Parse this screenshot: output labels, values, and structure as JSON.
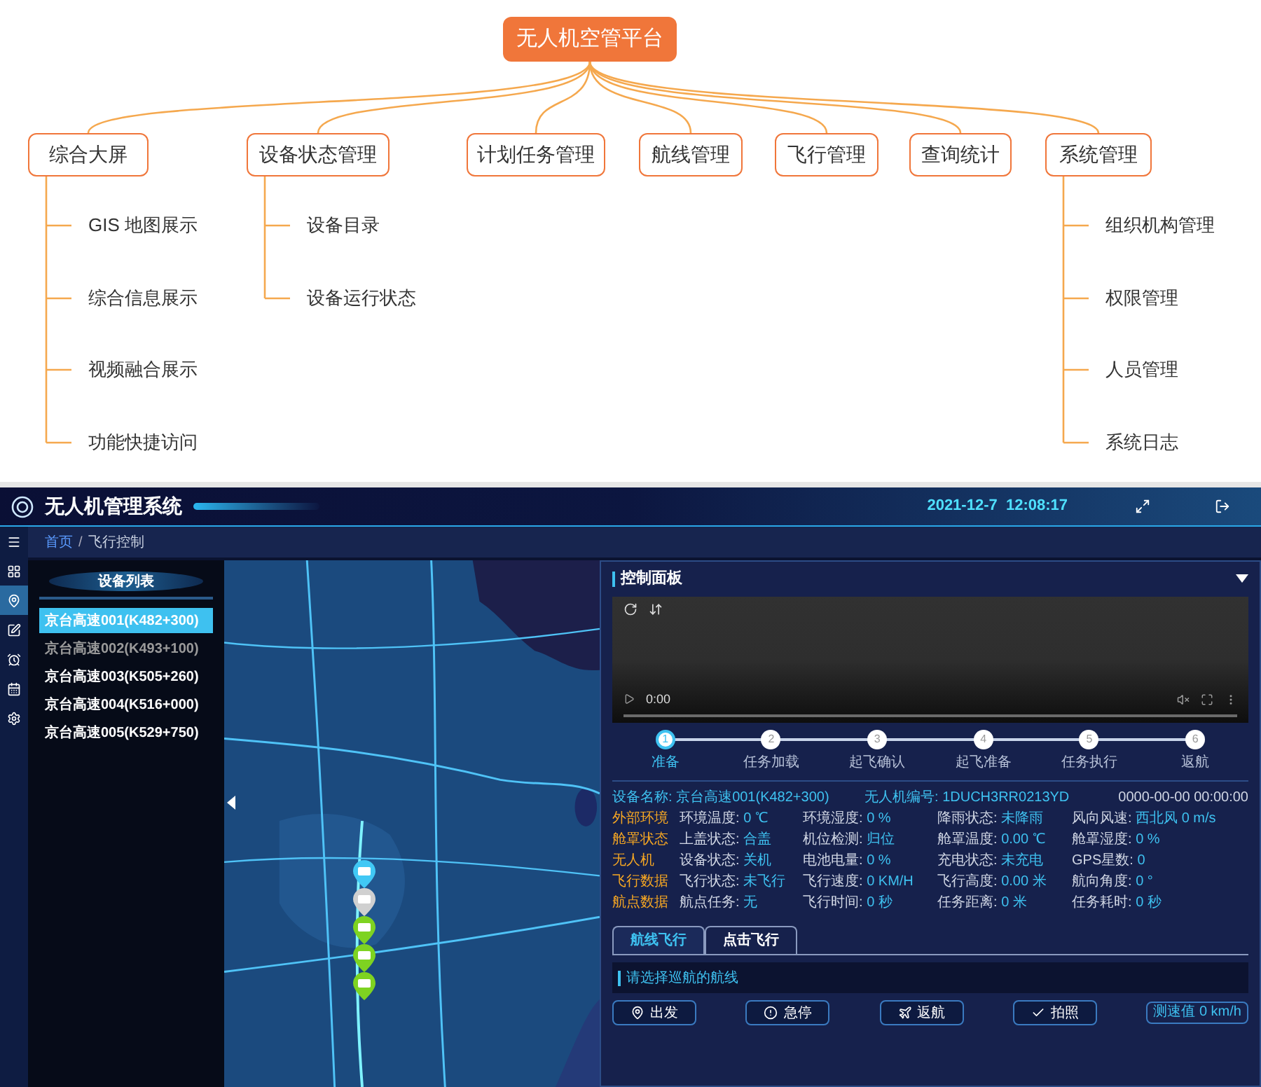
{
  "diagram": {
    "root": "无人机空管平台",
    "branches": [
      {
        "label": "综合大屏",
        "children": [
          "GIS 地图展示",
          "综合信息展示",
          "视频融合展示",
          "功能快捷访问"
        ]
      },
      {
        "label": "设备状态管理",
        "children": [
          "设备目录",
          "设备运行状态"
        ]
      },
      {
        "label": "计划任务管理"
      },
      {
        "label": "航线管理"
      },
      {
        "label": "飞行管理"
      },
      {
        "label": "查询统计"
      },
      {
        "label": "系统管理",
        "children": [
          "组织机构管理",
          "权限管理",
          "人员管理",
          "系统日志"
        ]
      }
    ]
  },
  "app": {
    "header": {
      "title": "无人机管理系统",
      "datetime": "2021-12-7  12:08:17"
    },
    "nav": [
      {
        "selected": false
      },
      {
        "selected": false
      },
      {
        "selected": true
      },
      {
        "selected": false
      },
      {
        "selected": false
      },
      {
        "selected": false
      },
      {
        "selected": false
      }
    ],
    "breadcrumb": {
      "items": [
        "首页",
        "飞行控制"
      ],
      "separator": "/"
    },
    "device_list": {
      "title": "设备列表",
      "items": [
        {
          "label": "京台高速001(K482+300)",
          "selected": true,
          "online": true
        },
        {
          "label": "京台高速002(K493+100)",
          "selected": false,
          "online": false
        },
        {
          "label": "京台高速003(K505+260)",
          "selected": false,
          "online": true
        },
        {
          "label": "京台高速004(K516+000)",
          "selected": false,
          "online": true
        },
        {
          "label": "京台高速005(K529+750)",
          "selected": false,
          "online": true
        }
      ]
    },
    "map": {
      "markers": [
        {
          "color": "#41c8f5"
        },
        {
          "color": "#d0d0d0"
        },
        {
          "color": "#7ed321"
        },
        {
          "color": "#7ed321"
        },
        {
          "color": "#7ed321"
        }
      ]
    },
    "control_panel": {
      "title": "控制面板",
      "video": {
        "time": "0:00"
      },
      "steps": [
        {
          "number": "1",
          "label": "准备",
          "selected": true
        },
        {
          "number": "2",
          "label": "任务加载",
          "selected": false
        },
        {
          "number": "3",
          "label": "起飞确认",
          "selected": false
        },
        {
          "number": "4",
          "label": "起飞准备",
          "selected": false
        },
        {
          "number": "5",
          "label": "任务执行",
          "selected": false
        },
        {
          "number": "6",
          "label": "返航",
          "selected": false
        }
      ],
      "device": {
        "name_label": "设备名称:",
        "name": "京台高速001(K482+300)",
        "id_label": "无人机编号:",
        "id": "1DUCH3RR0213YD",
        "timestamp": "0000-00-00 00:00:00"
      },
      "groups": [
        {
          "category": "外部环境",
          "fields": [
            {
              "label": "环境温度:",
              "value": "0 ℃"
            },
            {
              "label": "环境湿度:",
              "value": "0 %"
            },
            {
              "label": "降雨状态:",
              "value": "未降雨"
            },
            {
              "label": "风向风速:",
              "value": "西北风 0 m/s"
            }
          ]
        },
        {
          "category": "舱罩状态",
          "fields": [
            {
              "label": "上盖状态:",
              "value": "合盖"
            },
            {
              "label": "机位检测:",
              "value": "归位"
            },
            {
              "label": "舱罩温度:",
              "value": "0.00 ℃"
            },
            {
              "label": "舱罩湿度:",
              "value": "0 %"
            }
          ]
        },
        {
          "category": "无人机",
          "fields": [
            {
              "label": "设备状态:",
              "value": "关机"
            },
            {
              "label": "电池电量:",
              "value": "0 %"
            },
            {
              "label": "充电状态:",
              "value": "未充电"
            },
            {
              "label": "GPS星数:",
              "value": "0"
            }
          ]
        },
        {
          "category": "飞行数据",
          "fields": [
            {
              "label": "飞行状态:",
              "value": "未飞行"
            },
            {
              "label": "飞行速度:",
              "value": "0 KM/H"
            },
            {
              "label": "飞行高度:",
              "value": "0.00 米"
            },
            {
              "label": "航向角度:",
              "value": "0 °"
            }
          ]
        },
        {
          "category": "航点数据",
          "fields": [
            {
              "label": "航点任务:",
              "value": "无"
            },
            {
              "label": "飞行时间:",
              "value": "0 秒"
            },
            {
              "label": "任务距离:",
              "value": "0 米"
            },
            {
              "label": "任务耗时:",
              "value": "0 秒"
            }
          ]
        }
      ],
      "tabs": [
        {
          "label": "航线飞行",
          "selected": true
        },
        {
          "label": "点击飞行",
          "selected": false
        }
      ],
      "hint": "请选择巡航的航线",
      "buttons": [
        {
          "label": "出发",
          "kind": "depart"
        },
        {
          "label": "急停",
          "kind": "stop"
        },
        {
          "label": "返航",
          "kind": "return"
        },
        {
          "label": "拍照"
        }
      ],
      "speed": "测速值 0 km/h"
    }
  }
}
